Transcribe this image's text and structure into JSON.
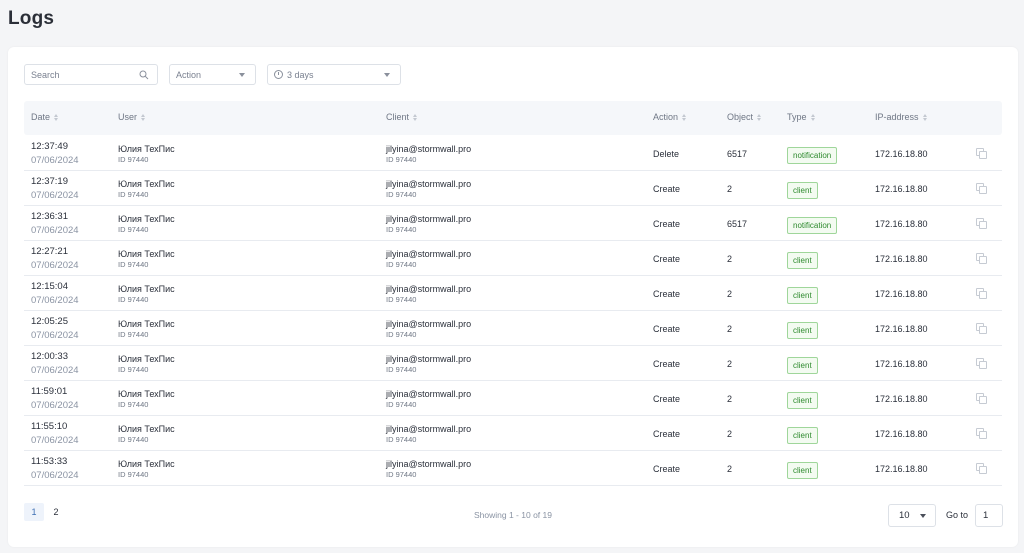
{
  "page": {
    "title": "Logs"
  },
  "filters": {
    "search_placeholder": "Search",
    "action_placeholder": "Action",
    "period_value": "3 days"
  },
  "table": {
    "columns": [
      "Date",
      "User",
      "Client",
      "Action",
      "Object",
      "Type",
      "IP-address"
    ],
    "rows": [
      {
        "time": "12:37:49",
        "date": "07/06/2024",
        "user": "Юлия ТехПис",
        "user_id": "ID 97440",
        "client": "jilyina@stormwall.pro",
        "client_id": "ID 97440",
        "action": "Delete",
        "object": "6517",
        "type": "notification",
        "ip": "172.16.18.80"
      },
      {
        "time": "12:37:19",
        "date": "07/06/2024",
        "user": "Юлия ТехПис",
        "user_id": "ID 97440",
        "client": "jilyina@stormwall.pro",
        "client_id": "ID 97440",
        "action": "Create",
        "object": "2",
        "type": "client",
        "ip": "172.16.18.80"
      },
      {
        "time": "12:36:31",
        "date": "07/06/2024",
        "user": "Юлия ТехПис",
        "user_id": "ID 97440",
        "client": "jilyina@stormwall.pro",
        "client_id": "ID 97440",
        "action": "Create",
        "object": "6517",
        "type": "notification",
        "ip": "172.16.18.80"
      },
      {
        "time": "12:27:21",
        "date": "07/06/2024",
        "user": "Юлия ТехПис",
        "user_id": "ID 97440",
        "client": "jilyina@stormwall.pro",
        "client_id": "ID 97440",
        "action": "Create",
        "object": "2",
        "type": "client",
        "ip": "172.16.18.80"
      },
      {
        "time": "12:15:04",
        "date": "07/06/2024",
        "user": "Юлия ТехПис",
        "user_id": "ID 97440",
        "client": "jilyina@stormwall.pro",
        "client_id": "ID 97440",
        "action": "Create",
        "object": "2",
        "type": "client",
        "ip": "172.16.18.80"
      },
      {
        "time": "12:05:25",
        "date": "07/06/2024",
        "user": "Юлия ТехПис",
        "user_id": "ID 97440",
        "client": "jilyina@stormwall.pro",
        "client_id": "ID 97440",
        "action": "Create",
        "object": "2",
        "type": "client",
        "ip": "172.16.18.80"
      },
      {
        "time": "12:00:33",
        "date": "07/06/2024",
        "user": "Юлия ТехПис",
        "user_id": "ID 97440",
        "client": "jilyina@stormwall.pro",
        "client_id": "ID 97440",
        "action": "Create",
        "object": "2",
        "type": "client",
        "ip": "172.16.18.80"
      },
      {
        "time": "11:59:01",
        "date": "07/06/2024",
        "user": "Юлия ТехПис",
        "user_id": "ID 97440",
        "client": "jilyina@stormwall.pro",
        "client_id": "ID 97440",
        "action": "Create",
        "object": "2",
        "type": "client",
        "ip": "172.16.18.80"
      },
      {
        "time": "11:55:10",
        "date": "07/06/2024",
        "user": "Юлия ТехПис",
        "user_id": "ID 97440",
        "client": "jilyina@stormwall.pro",
        "client_id": "ID 97440",
        "action": "Create",
        "object": "2",
        "type": "client",
        "ip": "172.16.18.80"
      },
      {
        "time": "11:53:33",
        "date": "07/06/2024",
        "user": "Юлия ТехПис",
        "user_id": "ID 97440",
        "client": "jilyina@stormwall.pro",
        "client_id": "ID 97440",
        "action": "Create",
        "object": "2",
        "type": "client",
        "ip": "172.16.18.80"
      }
    ]
  },
  "pagination": {
    "pages": [
      "1",
      "2"
    ],
    "current": "1",
    "showing": "Showing 1 - 10 of 19",
    "page_size": "10",
    "goto_label": "Go to",
    "goto_value": "1"
  },
  "icons": {
    "search": "search-icon",
    "sort": "sort-icon",
    "clock": "clock-icon",
    "copy": "copy-icon",
    "dropdown": "chevron-down-icon"
  },
  "colors": {
    "badge_text": "#2e8a2e",
    "badge_border": "#9fd69a",
    "active_page": "#3d6fb3"
  }
}
